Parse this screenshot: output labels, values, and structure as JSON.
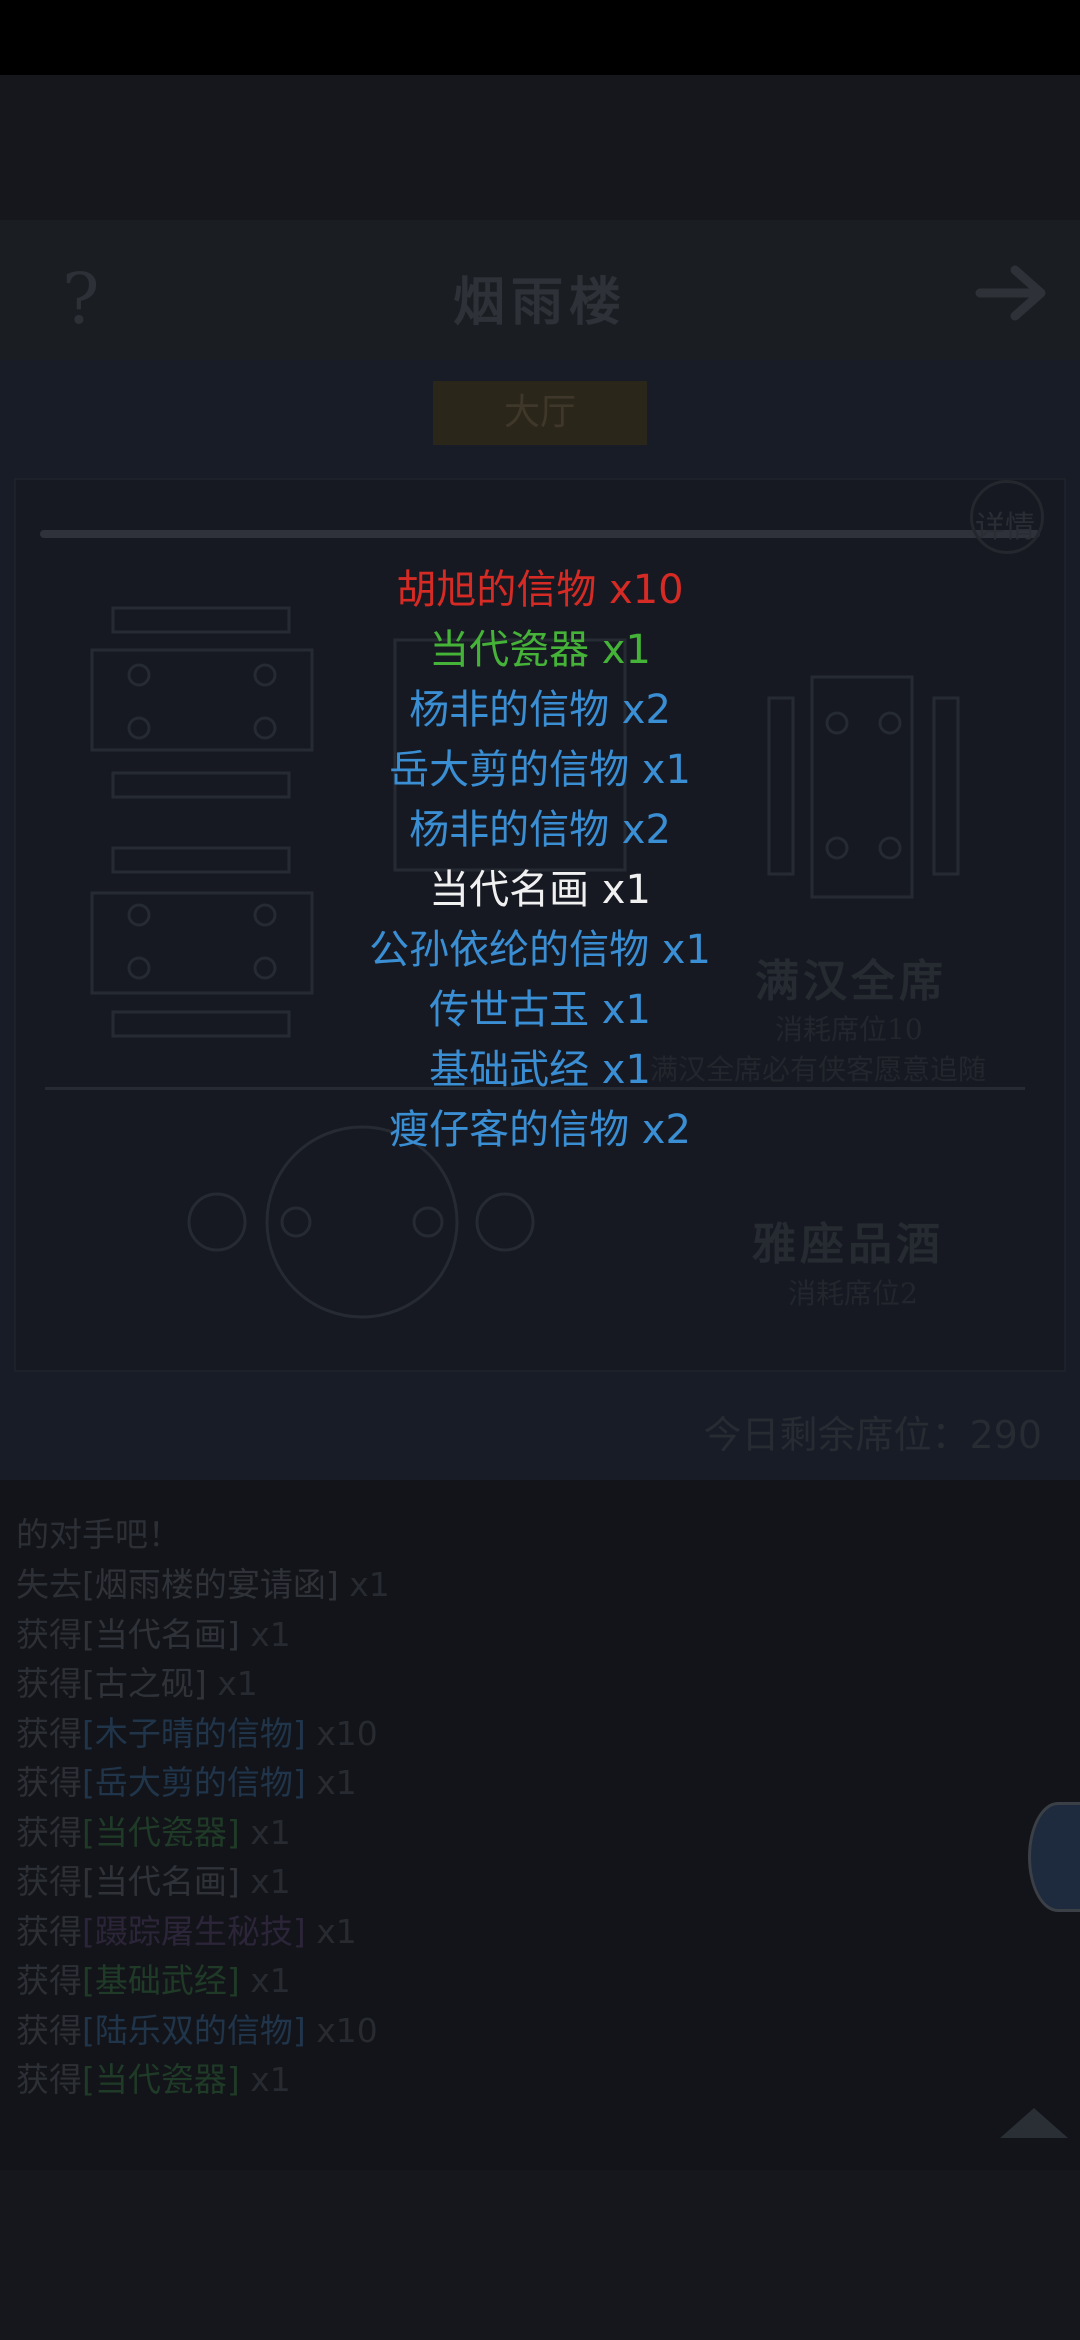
{
  "header": {
    "title": "烟雨楼",
    "help_symbol": "?",
    "next_icon": "arrow-right-icon"
  },
  "hall_tab": "大厅",
  "detail_label": "详情",
  "tables": [
    {
      "title": "满汉全席",
      "cost": "消耗席位10",
      "note": "满汉全席必有侠客愿意追随"
    },
    {
      "title": "雅座品酒",
      "cost": "消耗席位2"
    }
  ],
  "seats_left": "今日剩余席位：290",
  "rewards": [
    {
      "name": "胡旭的信物",
      "qty": " x10",
      "color": "#d62a24"
    },
    {
      "name": "当代瓷器",
      "qty": " x1",
      "color": "#45b337"
    },
    {
      "name": "杨非的信物",
      "qty": " x2",
      "color": "#3a8ed3"
    },
    {
      "name": "岳大剪的信物",
      "qty": " x1",
      "color": "#3a8ed3"
    },
    {
      "name": "杨非的信物",
      "qty": " x2",
      "color": "#3a8ed3"
    },
    {
      "name": "当代名画",
      "qty": " x1",
      "color": "#f0f0f0"
    },
    {
      "name": "公孙依纶的信物",
      "qty": " x1",
      "color": "#3a8ed3"
    },
    {
      "name": "传世古玉",
      "qty": " x1",
      "color": "#3a8ed3"
    },
    {
      "name": "基础武经",
      "qty": " x1",
      "color": "#3a8ed3"
    },
    {
      "name": "瘦仔客的信物",
      "qty": " x2",
      "color": "#3a8ed3"
    }
  ],
  "log": {
    "intro_tail": "的对手吧！",
    "entries": [
      {
        "verb": "失去",
        "item": "[烟雨楼的宴请函]",
        "qty": " x1",
        "color": "white"
      },
      {
        "verb": "获得",
        "item": "[当代名画]",
        "qty": " x1",
        "color": "white"
      },
      {
        "verb": "获得",
        "item": "[古之砚]",
        "qty": " x1",
        "color": "white"
      },
      {
        "verb": "获得",
        "item": "[木子晴的信物]",
        "qty": " x10",
        "color": "blue"
      },
      {
        "verb": "获得",
        "item": "[岳大剪的信物]",
        "qty": " x1",
        "color": "blue"
      },
      {
        "verb": "获得",
        "item": "[当代瓷器]",
        "qty": " x1",
        "color": "green"
      },
      {
        "verb": "获得",
        "item": "[当代名画]",
        "qty": " x1",
        "color": "white"
      },
      {
        "verb": "获得",
        "item": "[蹑踪屠生秘技]",
        "qty": " x1",
        "color": "purple"
      },
      {
        "verb": "获得",
        "item": "[基础武经]",
        "qty": " x1",
        "color": "green"
      },
      {
        "verb": "获得",
        "item": "[陆乐双的信物]",
        "qty": " x10",
        "color": "blue"
      },
      {
        "verb": "获得",
        "item": "[当代瓷器]",
        "qty": " x1",
        "color": "green"
      }
    ]
  }
}
